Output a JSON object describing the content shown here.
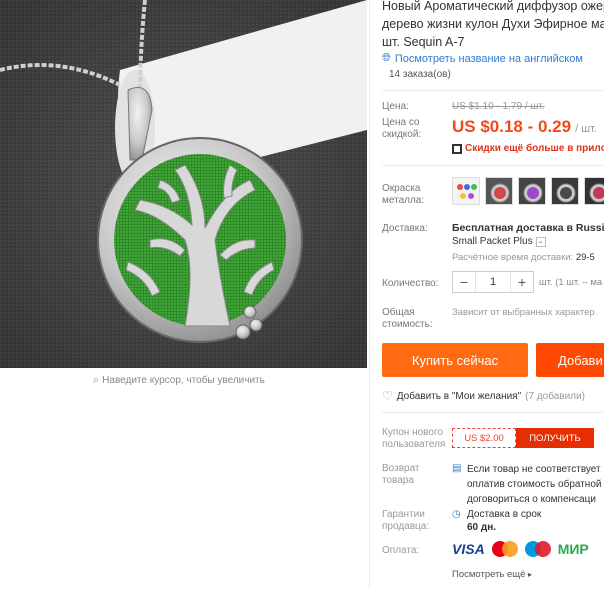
{
  "product": {
    "title_lines": [
      "Новый Ароматический диффузор ожер",
      "дерево жизни кулон Духи Эфирное ма",
      "шт. Sequin A-7"
    ],
    "translate_link": "Посмотреть название на английском",
    "orders": "14 заказа(ов)"
  },
  "image": {
    "zoom_hint": "Наведите курсор, чтобы увеличить"
  },
  "price": {
    "label": "Цена:",
    "old": "US $1.10 - 1.79 / шт.",
    "discount_label": "Цена со скидкой:",
    "new": "US $0.18 - 0.29",
    "unit": "/ шт.",
    "more_discounts": "Скидки ещё больше в прилож"
  },
  "color": {
    "label": "Окраска металла:",
    "swatches": [
      "swatch-1",
      "swatch-2",
      "swatch-3",
      "swatch-4",
      "swatch-5"
    ]
  },
  "shipping": {
    "label": "Доставка:",
    "free_text": "Бесплатная доставка в Russian",
    "method": "Small Packet Plus",
    "time_label": "Расчётное время доставки:",
    "time_value": "29-5"
  },
  "quantity": {
    "label": "Количество:",
    "minus": "−",
    "value": "1",
    "plus": "+",
    "note": "шт. (1 шт. – ма"
  },
  "total": {
    "label": "Общая стоимость:",
    "value": "Зависит от выбранных характер"
  },
  "actions": {
    "buy_now": "Купить сейчас",
    "add_to_cart": "Добави",
    "wishlist": "Добавить в \"Мои желания\"",
    "wishlist_count": "(7 добавили)"
  },
  "coupon": {
    "label": "Купон нового пользователя",
    "value": "US $2.00",
    "get": "ПОЛУЧИТЬ"
  },
  "returns": {
    "label": "Возврат товара",
    "lines": [
      "Если товар не соответствует",
      "оплатив стоимость обратной",
      "договориться о компенсаци"
    ]
  },
  "guarantee": {
    "label": "Гарантии продавца:",
    "text": "Доставка в срок",
    "days": "60 дн."
  },
  "payment": {
    "label": "Оплата:",
    "visa": "VISA",
    "mir": "МИР",
    "see_more": "Посмотреть ещё"
  },
  "colors": {
    "accent": "#ff6a13",
    "price": "#f24a1d",
    "link": "#2e7cd6",
    "coupon": "#e62e04"
  }
}
